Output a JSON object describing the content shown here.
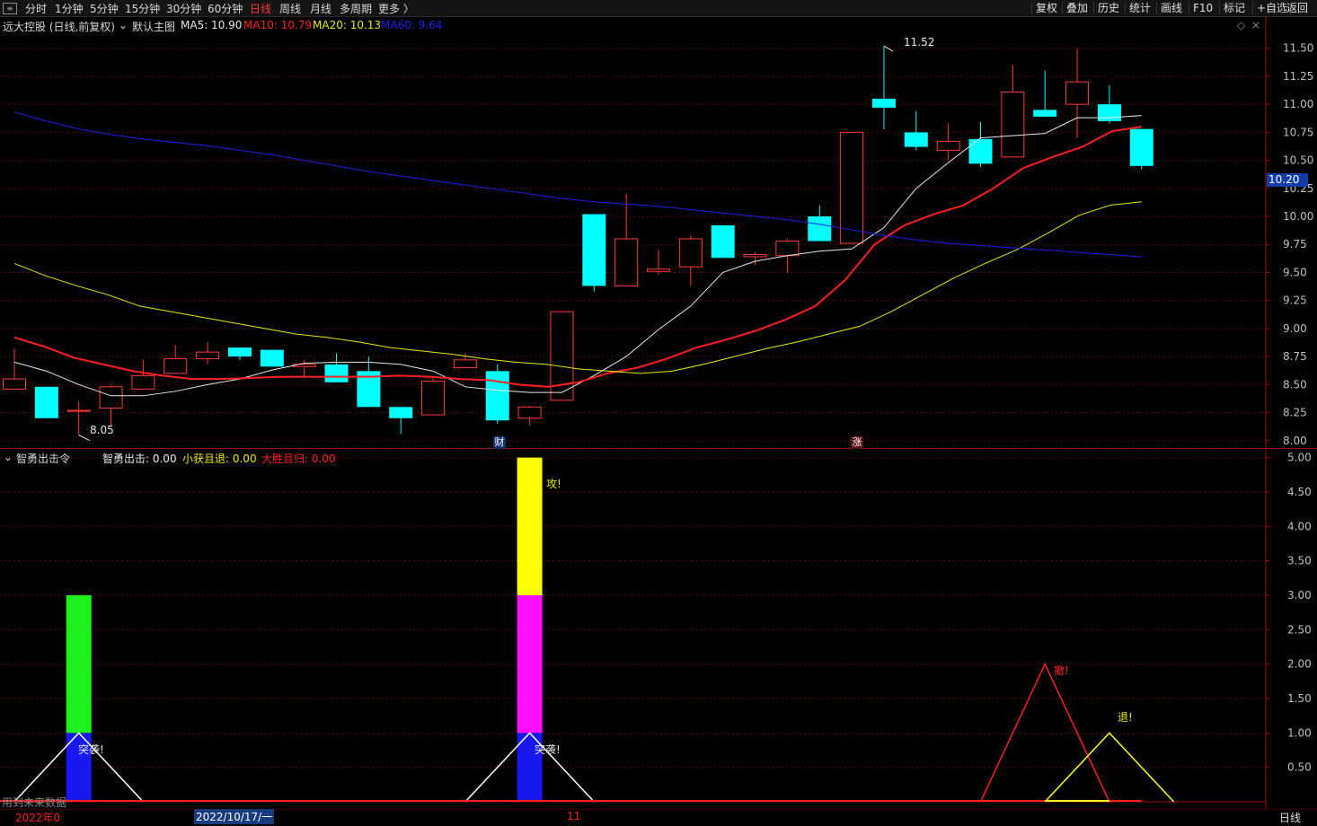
{
  "toolbar": {
    "periods": [
      "分时",
      "1分钟",
      "5分钟",
      "15分钟",
      "30分钟",
      "60分钟",
      "日线",
      "周线",
      "月线",
      "多周期",
      "更多 〉"
    ],
    "active_period": "日线",
    "right_buttons": [
      "复权",
      "叠加",
      "历史",
      "统计",
      "画线",
      "F10",
      "标记",
      "+自选",
      "返回"
    ]
  },
  "main_panel": {
    "stock_label": "远大控股 (日线,前复权)",
    "indicator_name": "默认主图",
    "ma": [
      {
        "label": "MA5: 10.90",
        "color": "#e8e8e8"
      },
      {
        "label": "MA10: 10.79",
        "color": "#ff2020"
      },
      {
        "label": "MA20: 10.13",
        "color": "#e8e800"
      },
      {
        "label": "MA60: 9.64",
        "color": "#2020e8"
      }
    ],
    "high_marker": "11.52",
    "low_marker": "8.05",
    "current_price_tag": "10.20",
    "event_markers": [
      "财",
      "涨"
    ]
  },
  "sub_panel": {
    "indicator_name": "智勇出击令",
    "values": [
      {
        "label": "智勇出击: 0.00",
        "color": "#e8e8e8"
      },
      {
        "label": "小获且退: 0.00",
        "color": "#e8e800"
      },
      {
        "label": "大胜且归: 0.00",
        "color": "#ff2020"
      }
    ],
    "texts": [
      "突袭!",
      "突袭!",
      "攻!",
      "撤!",
      "退!"
    ],
    "footer_note": "用到未来数据"
  },
  "bottom_bar": {
    "year_label": "2022年0",
    "date_label": "2022/10/17/一",
    "month_label": "11",
    "period_label": "日线"
  },
  "chart_data": [
    {
      "type": "candlestick",
      "title": "远大控股 (日线,前复权)",
      "ylim": [
        7.95,
        11.65
      ],
      "yticks": [
        "11.50",
        "11.25",
        "11.00",
        "10.75",
        "10.50",
        "10.25",
        "10.00",
        "9.75",
        "9.50",
        "9.25",
        "9.00",
        "8.75",
        "8.50",
        "8.25",
        "8.00"
      ],
      "ohlc": [
        [
          8.46,
          8.82,
          8.46,
          8.55
        ],
        [
          8.48,
          8.48,
          8.2,
          8.2
        ],
        [
          8.27,
          8.35,
          8.05,
          8.27
        ],
        [
          8.29,
          8.5,
          8.12,
          8.48
        ],
        [
          8.46,
          8.72,
          8.46,
          8.58
        ],
        [
          8.6,
          8.85,
          8.6,
          8.73
        ],
        [
          8.73,
          8.88,
          8.68,
          8.79
        ],
        [
          8.83,
          8.83,
          8.72,
          8.75
        ],
        [
          8.81,
          8.81,
          8.66,
          8.66
        ],
        [
          8.66,
          8.72,
          8.56,
          8.68
        ],
        [
          8.68,
          8.78,
          8.52,
          8.52
        ],
        [
          8.62,
          8.75,
          8.3,
          8.3
        ],
        [
          8.3,
          8.3,
          8.06,
          8.2
        ],
        [
          8.23,
          8.56,
          8.23,
          8.53
        ],
        [
          8.65,
          8.78,
          8.65,
          8.72
        ],
        [
          8.62,
          8.68,
          8.15,
          8.18
        ],
        [
          8.2,
          8.31,
          8.14,
          8.3
        ],
        [
          8.36,
          9.15,
          8.36,
          9.15
        ],
        [
          10.02,
          10.02,
          9.33,
          9.38
        ],
        [
          9.38,
          10.2,
          9.38,
          9.8
        ],
        [
          9.51,
          9.7,
          9.48,
          9.53
        ],
        [
          9.55,
          9.83,
          9.38,
          9.8
        ],
        [
          9.92,
          9.92,
          9.65,
          9.63
        ],
        [
          9.64,
          9.68,
          9.57,
          9.66
        ],
        [
          9.65,
          9.8,
          9.5,
          9.78
        ],
        [
          10.0,
          10.1,
          9.78,
          9.78
        ],
        [
          9.76,
          10.75,
          9.76,
          10.75
        ],
        [
          11.05,
          11.52,
          10.78,
          10.97
        ],
        [
          10.75,
          10.94,
          10.59,
          10.62
        ],
        [
          10.59,
          10.83,
          10.5,
          10.67
        ],
        [
          10.69,
          10.84,
          10.44,
          10.47
        ],
        [
          10.53,
          11.35,
          10.53,
          11.11
        ],
        [
          10.95,
          11.3,
          10.9,
          10.89
        ],
        [
          11.0,
          11.5,
          10.7,
          11.2
        ],
        [
          11.0,
          11.17,
          10.83,
          10.85
        ],
        [
          10.78,
          10.78,
          10.42,
          10.45
        ]
      ],
      "series": [
        {
          "name": "MA5",
          "values": [
            8.7,
            8.62,
            8.5,
            8.4,
            8.4,
            8.44,
            8.5,
            8.55,
            8.63,
            8.69,
            8.7,
            8.7,
            8.68,
            8.62,
            8.48,
            8.45,
            8.43,
            8.43,
            8.58,
            8.75,
            8.99,
            9.2,
            9.5,
            9.6,
            9.65,
            9.69,
            9.71,
            9.9,
            10.25,
            10.48,
            10.7,
            10.72,
            10.74,
            10.88,
            10.88,
            10.9
          ]
        },
        {
          "name": "MA10",
          "values": [
            8.92,
            8.84,
            8.74,
            8.68,
            8.62,
            8.58,
            8.55,
            8.55,
            8.56,
            8.57,
            8.57,
            8.57,
            8.57,
            8.58,
            8.57,
            8.55,
            8.54,
            8.5,
            8.48,
            8.52,
            8.6,
            8.65,
            8.73,
            8.83,
            8.9,
            8.98,
            9.08,
            9.2,
            9.43,
            9.75,
            9.92,
            10.02,
            10.1,
            10.25,
            10.43,
            10.53,
            10.62,
            10.76,
            10.8
          ]
        },
        {
          "name": "MA20",
          "values": [
            9.58,
            9.47,
            9.38,
            9.3,
            9.2,
            9.15,
            9.1,
            9.05,
            9.0,
            8.95,
            8.92,
            8.88,
            8.83,
            8.8,
            8.77,
            8.73,
            8.7,
            8.68,
            8.64,
            8.62,
            8.6,
            8.62,
            8.68,
            8.75,
            8.82,
            8.88,
            8.95,
            9.02,
            9.15,
            9.3,
            9.45,
            9.58,
            9.7,
            9.85,
            10.01,
            10.1,
            10.13
          ]
        },
        {
          "name": "MA60",
          "values": [
            10.93,
            10.85,
            10.78,
            10.73,
            10.69,
            10.66,
            10.63,
            10.59,
            10.55,
            10.5,
            10.45,
            10.4,
            10.36,
            10.32,
            10.28,
            10.24,
            10.2,
            10.16,
            10.13,
            10.11,
            10.09,
            10.06,
            10.03,
            10.0,
            9.97,
            9.93,
            9.88,
            9.83,
            9.79,
            9.76,
            9.74,
            9.72,
            9.7,
            9.68,
            9.66,
            9.64
          ]
        }
      ]
    },
    {
      "type": "bar",
      "title": "智勇出击令",
      "ylim": [
        0,
        5.1
      ],
      "yticks": [
        "5.00",
        "4.50",
        "4.00",
        "3.50",
        "3.00",
        "2.50",
        "2.00",
        "1.50",
        "1.00",
        "0.50"
      ],
      "stacked_bars": [
        {
          "index": 2,
          "segments": [
            {
              "from": 0,
              "to": 1,
              "color": "#1818f0"
            },
            {
              "from": 1,
              "to": 3,
              "color": "#1ef01e"
            }
          ]
        },
        {
          "index": 16,
          "segments": [
            {
              "from": 0,
              "to": 1,
              "color": "#1818f0"
            },
            {
              "from": 1,
              "to": 3,
              "color": "#ff10ff"
            },
            {
              "from": 3,
              "to": 5,
              "color": "#ffff00"
            }
          ]
        }
      ],
      "series": [
        {
          "name": "智勇出击",
          "color": "#ffffff",
          "peaks": [
            {
              "index": 2,
              "value": 1
            },
            {
              "index": 16,
              "value": 1
            }
          ]
        },
        {
          "name": "大胜且归",
          "color": "#ff2020",
          "peaks": [
            {
              "index": 32,
              "value": 2
            }
          ]
        },
        {
          "name": "小获且退",
          "color": "#ffff20",
          "peaks": [
            {
              "index": 34,
              "value": 1
            }
          ]
        }
      ]
    }
  ]
}
